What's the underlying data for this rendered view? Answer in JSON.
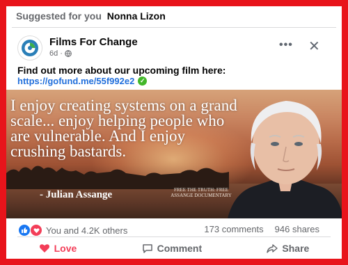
{
  "header": {
    "suggested_label": "Suggested for you",
    "suggested_name": "Nonna Lizon"
  },
  "post": {
    "page_name": "Films For Change",
    "time": "6d",
    "caption": "Find out more about our upcoming film here:",
    "link": "https://gofund.me/55f992e2",
    "image": {
      "quote": "I enjoy creating systems on a grand scale... enjoy helping people who are vulnerable. And I enjoy crushing bastards.",
      "attribution": "- Julian Assange",
      "doc_label": "FREE THE TRUTH: FREE ASSANGE DOCUMENTARY"
    }
  },
  "stats": {
    "reactions_text": "You and 4.2K others",
    "comments": "173 comments",
    "shares": "946 shares"
  },
  "actions": {
    "love": "Love",
    "comment": "Comment",
    "share": "Share"
  },
  "colors": {
    "frame": "#e8141b",
    "link": "#216fdb",
    "love": "#f33e58",
    "like": "#1877f2"
  }
}
